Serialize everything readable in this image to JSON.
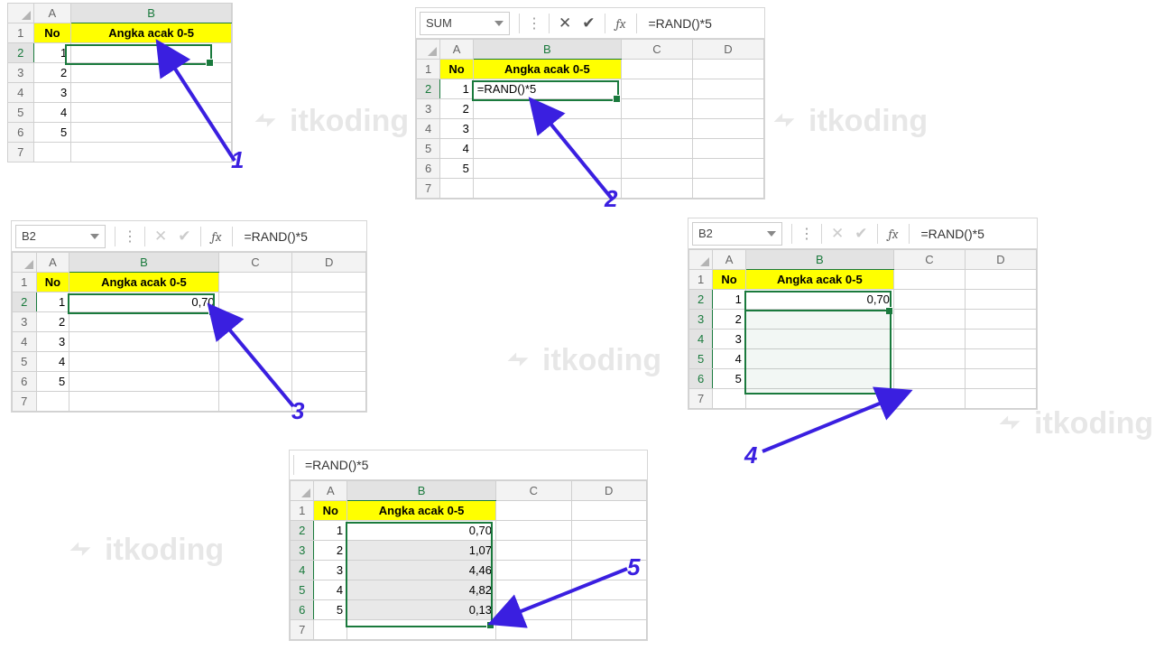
{
  "watermark_text": "itkoding",
  "labels": {
    "no": "No",
    "angka": "Angka acak 0-5"
  },
  "formula_text": "=RAND()*5",
  "step1": {
    "cols": [
      "A",
      "B"
    ],
    "rows": [
      "1",
      "2",
      "3",
      "4",
      "5",
      "6",
      "7"
    ],
    "a": [
      "1",
      "2",
      "3",
      "4",
      "5"
    ],
    "label": "1"
  },
  "step2": {
    "namebox": "SUM",
    "cols": [
      "A",
      "B",
      "C",
      "D"
    ],
    "rows": [
      "1",
      "2",
      "3",
      "4",
      "5",
      "6",
      "7"
    ],
    "a": [
      "1",
      "2",
      "3",
      "4",
      "5"
    ],
    "b2": "=RAND()*5",
    "label": "2"
  },
  "step3": {
    "namebox": "B2",
    "cols": [
      "A",
      "B",
      "C",
      "D"
    ],
    "rows": [
      "1",
      "2",
      "3",
      "4",
      "5",
      "6",
      "7"
    ],
    "a": [
      "1",
      "2",
      "3",
      "4",
      "5"
    ],
    "b2": "0,70",
    "label": "3"
  },
  "step4": {
    "namebox": "B2",
    "cols": [
      "A",
      "B",
      "C",
      "D"
    ],
    "rows": [
      "1",
      "2",
      "3",
      "4",
      "5",
      "6",
      "7"
    ],
    "a": [
      "1",
      "2",
      "3",
      "4",
      "5"
    ],
    "b2": "0,70",
    "label": "4"
  },
  "step5": {
    "cols": [
      "A",
      "B",
      "C",
      "D"
    ],
    "rows": [
      "1",
      "2",
      "3",
      "4",
      "5",
      "6",
      "7"
    ],
    "a": [
      "1",
      "2",
      "3",
      "4",
      "5"
    ],
    "b": [
      "0,70",
      "1,07",
      "4,46",
      "4,82",
      "0,13"
    ],
    "label": "5"
  }
}
